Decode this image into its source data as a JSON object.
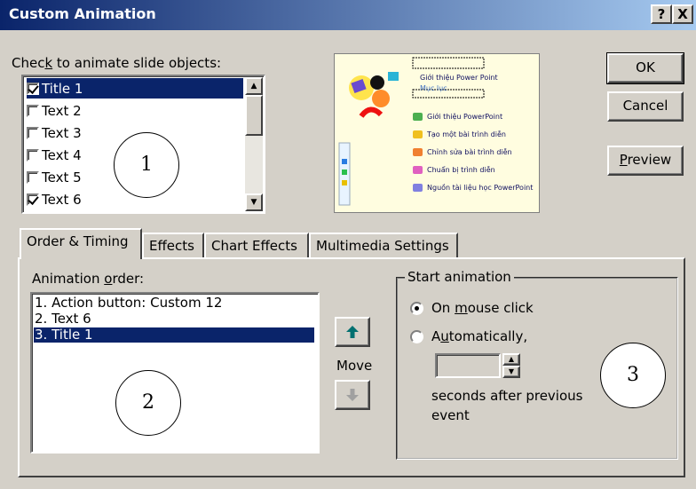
{
  "window": {
    "title": "Custom Animation",
    "help_button": "?",
    "close_button": "X"
  },
  "objects": {
    "label_pre": "Chec",
    "label_key": "k",
    "label_post": " to animate slide objects:",
    "items": [
      {
        "label": "Title 1",
        "checked": true,
        "selected": true
      },
      {
        "label": "Text 2",
        "checked": false,
        "selected": false
      },
      {
        "label": "Text 3",
        "checked": false,
        "selected": false
      },
      {
        "label": "Text 4",
        "checked": false,
        "selected": false
      },
      {
        "label": "Text 5",
        "checked": false,
        "selected": false
      },
      {
        "label": "Text 6",
        "checked": true,
        "selected": false
      }
    ]
  },
  "preview": {
    "title_line": "Giới thiệu Power Point",
    "subtitle_line": "Mục lục",
    "bullets": [
      "Giới thiệu PowerPoint",
      "Tạo một bài trình diễn",
      "Chỉnh sửa bài trình diễn",
      "Chuẩn bị trình diễn",
      "Nguồn tài liệu học PowerPoint"
    ]
  },
  "buttons": {
    "ok": "OK",
    "cancel": "Cancel",
    "preview_key": "P",
    "preview_rest": "review"
  },
  "tabs": [
    {
      "label": "Order & Timing",
      "active": true
    },
    {
      "label": "Effects",
      "active": false
    },
    {
      "label": "Chart Effects",
      "active": false
    },
    {
      "label": "Multimedia Settings",
      "active": false
    }
  ],
  "order": {
    "label_pre": "Animation ",
    "label_key": "o",
    "label_post": "rder:",
    "items": [
      {
        "label": "1. Action button: Custom 12",
        "selected": false
      },
      {
        "label": "2. Text 6",
        "selected": false
      },
      {
        "label": "3. Title 1",
        "selected": true
      }
    ],
    "move_label": "Move"
  },
  "start_animation": {
    "legend": "Start animation",
    "on_click_pre": "On ",
    "on_click_key": "m",
    "on_click_post": "ouse click",
    "auto_pre": "A",
    "auto_key": "u",
    "auto_post": "tomatically,",
    "seconds_value": "",
    "seconds_label_1": "seconds after previous",
    "seconds_label_2": "event",
    "selected": "on_mouse_click"
  },
  "annotations": [
    "1",
    "2",
    "3"
  ],
  "colors": {
    "title_bar": "#0a246a",
    "selection": "#0a246a",
    "arrow_up": "#007070"
  }
}
